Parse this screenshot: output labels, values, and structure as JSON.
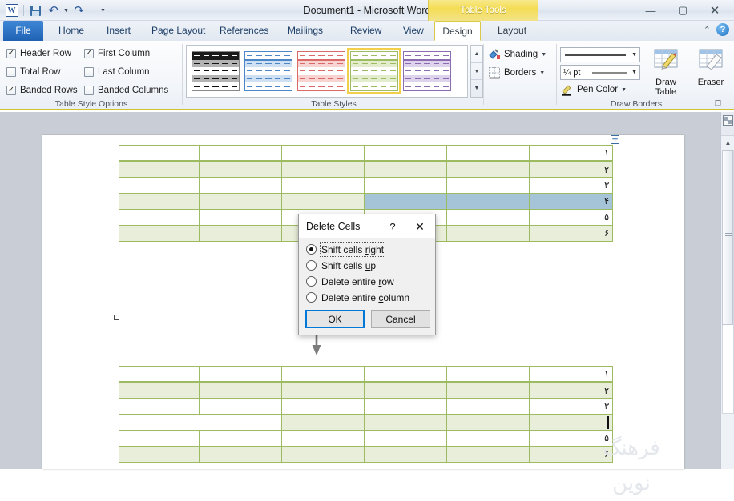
{
  "window": {
    "title": "Document1  -  Microsoft Word",
    "contextual_tab_group": "Table Tools",
    "minimize": "—",
    "maximize": "▢",
    "close": "✕"
  },
  "quick_access": {
    "app_logo": "W",
    "items": [
      {
        "name": "save-icon",
        "label": "Save"
      },
      {
        "name": "undo-icon",
        "label": "Undo"
      },
      {
        "name": "redo-icon",
        "label": "Redo"
      },
      {
        "name": "customize-qat-icon",
        "label": "Customize Quick Access Toolbar"
      }
    ]
  },
  "ribbon_tabs": [
    {
      "label": "File",
      "state": "file"
    },
    {
      "label": "Home",
      "state": "normal"
    },
    {
      "label": "Insert",
      "state": "normal"
    },
    {
      "label": "Page Layout",
      "state": "normal"
    },
    {
      "label": "References",
      "state": "normal"
    },
    {
      "label": "Mailings",
      "state": "normal"
    },
    {
      "label": "Review",
      "state": "normal"
    },
    {
      "label": "View",
      "state": "normal"
    },
    {
      "label": "Design",
      "state": "active"
    },
    {
      "label": "Layout",
      "state": "normal"
    }
  ],
  "ribbon_right": {
    "minimize_ribbon": "⌃",
    "help": "?"
  },
  "ribbon": {
    "table_style_options": {
      "group_label": "Table Style Options",
      "checkboxes": [
        {
          "label": "Header Row",
          "checked": true
        },
        {
          "label": "First Column",
          "checked": true
        },
        {
          "label": "Total Row",
          "checked": false
        },
        {
          "label": "Last Column",
          "checked": false
        },
        {
          "label": "Banded Rows",
          "checked": true
        },
        {
          "label": "Banded Columns",
          "checked": false
        }
      ]
    },
    "table_styles": {
      "group_label": "Table Styles",
      "thumbnails": [
        {
          "name": "style-plain-black",
          "color": "#1a1a1a",
          "band": "#b3b3b3",
          "selected": false
        },
        {
          "name": "style-blue",
          "color": "#4a86c8",
          "band": "#cfe0f2",
          "selected": false
        },
        {
          "name": "style-red",
          "color": "#d96a68",
          "band": "#f7d4d2",
          "selected": false
        },
        {
          "name": "style-green",
          "color": "#9dbb61",
          "band": "#e3edcd",
          "selected": true
        },
        {
          "name": "style-purple",
          "color": "#8b6cb0",
          "band": "#ded3ec",
          "selected": false
        }
      ],
      "scroll_up": "▲",
      "scroll_down": "▼",
      "more": "▼"
    },
    "shading_borders": {
      "shading_label": "Shading",
      "borders_label": "Borders"
    },
    "draw_borders": {
      "group_label": "Draw Borders",
      "line_style_value": "",
      "line_weight_value": "¼ pt",
      "pen_color_label": "Pen Color",
      "draw_table_label_line1": "Draw",
      "draw_table_label_line2": "Table",
      "eraser_label": "Eraser",
      "dialog_launcher": "❐"
    }
  },
  "document": {
    "table_top": {
      "rows": [
        {
          "num": "۱",
          "banded": false,
          "header": true,
          "selected": false
        },
        {
          "num": "۲",
          "banded": true,
          "header": false,
          "selected": false
        },
        {
          "num": "۳",
          "banded": false,
          "header": false,
          "selected": false
        },
        {
          "num": "۴",
          "banded": true,
          "header": false,
          "selected": true
        },
        {
          "num": "۵",
          "banded": false,
          "header": false,
          "selected": false
        },
        {
          "num": "۶",
          "banded": true,
          "header": false,
          "selected": false
        }
      ],
      "columns": 6,
      "move_handle": "✛"
    },
    "table_bottom": {
      "rows": [
        {
          "num": "۱",
          "banded": false,
          "header": true,
          "merged": false
        },
        {
          "num": "۲",
          "banded": true,
          "header": false,
          "merged": false
        },
        {
          "num": "۳",
          "banded": false,
          "header": false,
          "merged": false
        },
        {
          "num": "",
          "banded": true,
          "header": false,
          "merged": true
        },
        {
          "num": "۵",
          "banded": false,
          "header": false,
          "merged": false
        },
        {
          "num": "۶",
          "banded": true,
          "header": false,
          "merged": false
        }
      ],
      "columns": 6
    },
    "watermark": "فرهنگ نوین",
    "annotation_arrow": "down-arrow-annotation"
  },
  "dialog": {
    "title": "Delete Cells",
    "help_glyph": "?",
    "close_glyph": "✕",
    "options": [
      {
        "label_pre": "Shift cells ",
        "label_key": "r",
        "label_post": "ight",
        "selected": true,
        "focused": true
      },
      {
        "label_pre": "Shift cells ",
        "label_key": "u",
        "label_post": "p",
        "selected": false,
        "focused": false
      },
      {
        "label_pre": "Delete entire ",
        "label_key": "r",
        "label_post": "ow",
        "selected": false,
        "focused": false
      },
      {
        "label_pre": "Delete entire ",
        "label_key": "c",
        "label_post": "olumn",
        "selected": false,
        "focused": false
      }
    ],
    "ok_label": "OK",
    "cancel_label": "Cancel"
  },
  "colors": {
    "table_border_green": "#9dbb61",
    "table_band_green": "#e8eed9",
    "selection_blue": "#a6c4d8",
    "contextual_yellow": "#f4dd55",
    "file_tab_blue": "#2a6cb8",
    "dialog_default_border": "#0078d7"
  }
}
